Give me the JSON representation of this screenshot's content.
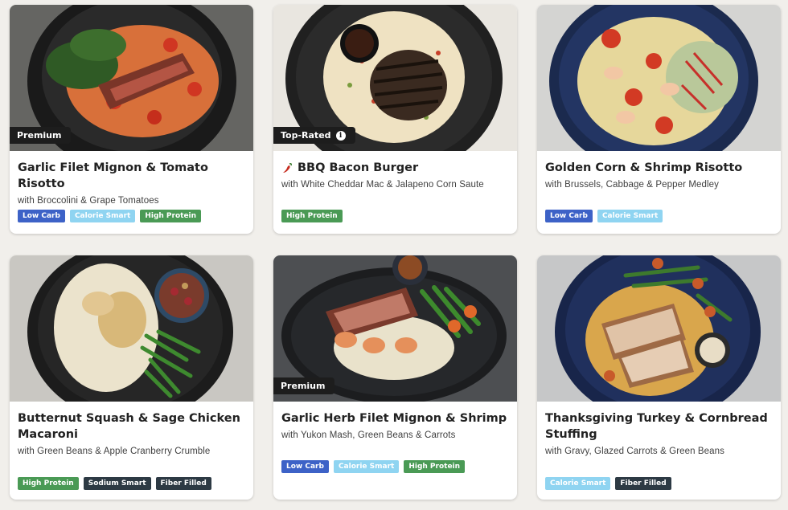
{
  "colors": {
    "page_bg": "#f1efeb",
    "badge_bg": "#1d1d1d",
    "low_carb": "#3d62c7",
    "calorie_smart": "#8fd4f1",
    "high_protein": "#4a9a55",
    "sodium_smart": "#2d3a44",
    "fiber_filled": "#2d3a44"
  },
  "meals": [
    {
      "title": "Garlic Filet Mignon & Tomato Risotto",
      "subtitle": "with Broccolini & Grape Tomatoes",
      "badge": "Premium",
      "title_icon": "",
      "tags": [
        {
          "label": "Low Carb",
          "kind": "low-carb"
        },
        {
          "label": "Calorie Smart",
          "kind": "calorie-smart"
        },
        {
          "label": "High Protein",
          "kind": "high-protein"
        }
      ]
    },
    {
      "title": "BBQ Bacon Burger",
      "subtitle": "with White Cheddar Mac & Jalapeno Corn Saute",
      "badge": "Top-Rated",
      "badge_icon": "info-icon",
      "title_icon": "chili-pepper-icon",
      "tags": [
        {
          "label": "High Protein",
          "kind": "high-protein"
        }
      ]
    },
    {
      "title": "Golden Corn & Shrimp Risotto",
      "subtitle": "with Brussels, Cabbage & Pepper Medley",
      "badge": "",
      "title_icon": "",
      "tags": [
        {
          "label": "Low Carb",
          "kind": "low-carb"
        },
        {
          "label": "Calorie Smart",
          "kind": "calorie-smart"
        }
      ]
    },
    {
      "title": "Butternut Squash & Sage Chicken Macaroni",
      "subtitle": "with Green Beans & Apple Cranberry Crumble",
      "badge": "",
      "title_icon": "",
      "tags": [
        {
          "label": "High Protein",
          "kind": "high-protein"
        },
        {
          "label": "Sodium Smart",
          "kind": "sodium-smart"
        },
        {
          "label": "Fiber Filled",
          "kind": "fiber-filled"
        }
      ]
    },
    {
      "title": "Garlic Herb Filet Mignon & Shrimp",
      "subtitle": "with Yukon Mash, Green Beans & Carrots",
      "badge": "Premium",
      "title_icon": "",
      "tags": [
        {
          "label": "Low Carb",
          "kind": "low-carb"
        },
        {
          "label": "Calorie Smart",
          "kind": "calorie-smart"
        },
        {
          "label": "High Protein",
          "kind": "high-protein"
        }
      ]
    },
    {
      "title": "Thanksgiving Turkey & Cornbread Stuffing",
      "subtitle": "with Gravy, Glazed Carrots & Green Beans",
      "badge": "",
      "title_icon": "",
      "tags": [
        {
          "label": "Calorie Smart",
          "kind": "calorie-smart"
        },
        {
          "label": "Fiber Filled",
          "kind": "fiber-filled"
        }
      ]
    }
  ]
}
